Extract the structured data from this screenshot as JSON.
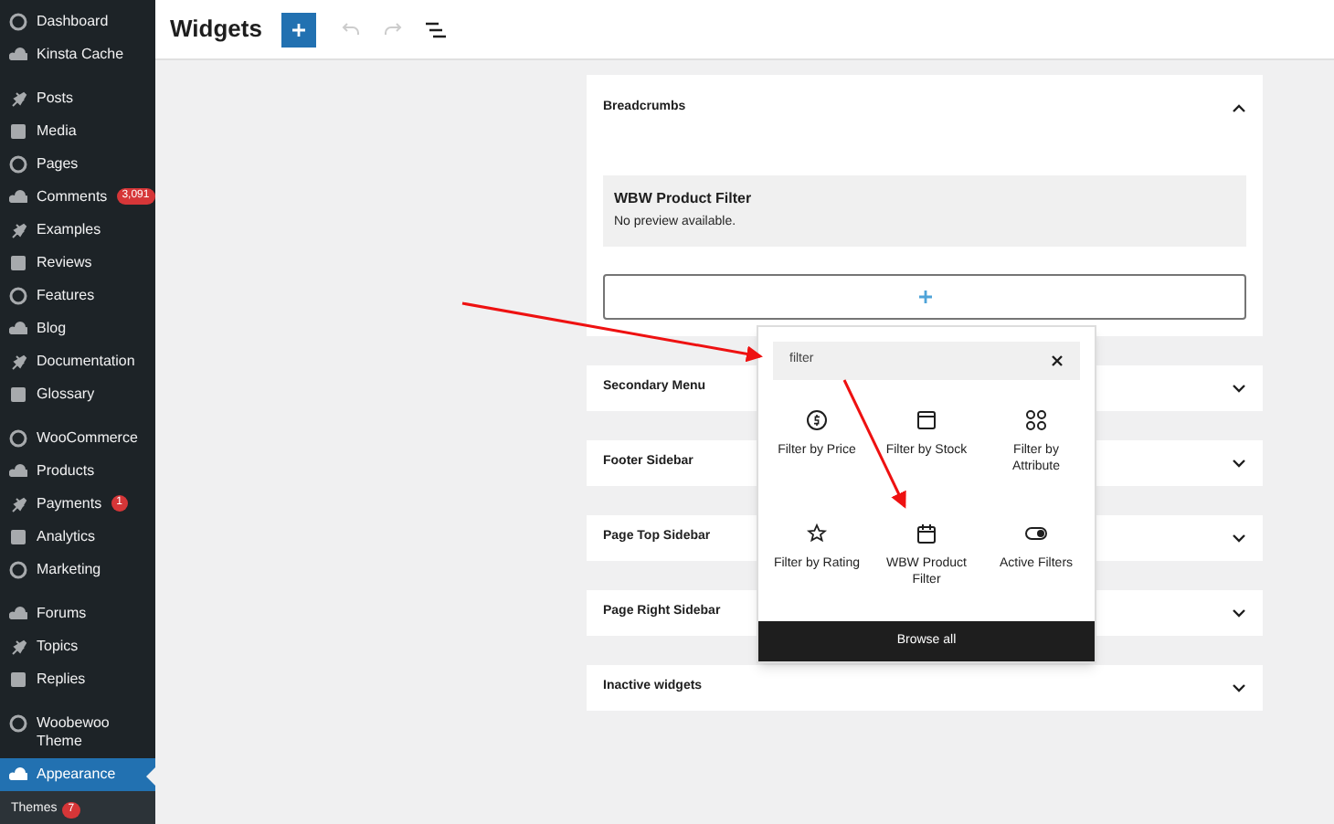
{
  "sidebar": {
    "groups": [
      {
        "items": [
          {
            "label": "Dashboard",
            "selected": false
          },
          {
            "label": "Kinsta Cache",
            "selected": false
          }
        ]
      },
      {
        "items": [
          {
            "label": "Posts",
            "selected": false
          },
          {
            "label": "Media",
            "selected": false
          },
          {
            "label": "Pages",
            "selected": false
          },
          {
            "label": "Comments",
            "badge": "3,091",
            "selected": false
          },
          {
            "label": "Examples",
            "selected": false
          },
          {
            "label": "Reviews",
            "selected": false
          },
          {
            "label": "Features",
            "selected": false
          },
          {
            "label": "Blog",
            "selected": false
          },
          {
            "label": "Documentation",
            "selected": false
          },
          {
            "label": "Glossary",
            "selected": false
          }
        ]
      },
      {
        "items": [
          {
            "label": "WooCommerce",
            "selected": false
          },
          {
            "label": "Products",
            "selected": false
          },
          {
            "label": "Payments",
            "badge": "1",
            "selected": false
          },
          {
            "label": "Analytics",
            "selected": false
          },
          {
            "label": "Marketing",
            "selected": false
          }
        ]
      },
      {
        "items": [
          {
            "label": "Forums",
            "selected": false
          },
          {
            "label": "Topics",
            "selected": false
          },
          {
            "label": "Replies",
            "selected": false
          }
        ]
      },
      {
        "items": [
          {
            "label": "Woobewoo Theme",
            "selected": false
          },
          {
            "label": "Appearance",
            "selected": true
          }
        ]
      }
    ],
    "submenu": [
      {
        "label": "Themes",
        "badge": "7"
      }
    ]
  },
  "header": {
    "title": "Widgets"
  },
  "widget_areas": [
    {
      "title": "Breadcrumbs",
      "expanded": true,
      "blocks": [
        {
          "title": "WBW Product Filter",
          "note": "No preview available."
        }
      ]
    },
    {
      "title": "Secondary Menu",
      "expanded": false
    },
    {
      "title": "Footer Sidebar",
      "expanded": false
    },
    {
      "title": "Page Top Sidebar",
      "expanded": false
    },
    {
      "title": "Page Right Sidebar",
      "expanded": false
    },
    {
      "title": "Inactive widgets",
      "expanded": false
    }
  ],
  "inserter": {
    "search": {
      "value": "filter"
    },
    "results": [
      {
        "label": "Filter by Price"
      },
      {
        "label": "Filter by Stock"
      },
      {
        "label": "Filter by Attribute"
      },
      {
        "label": "Filter by Rating"
      },
      {
        "label": "WBW Product Filter"
      },
      {
        "label": "Active Filters"
      }
    ],
    "browse_all": "Browse all"
  }
}
